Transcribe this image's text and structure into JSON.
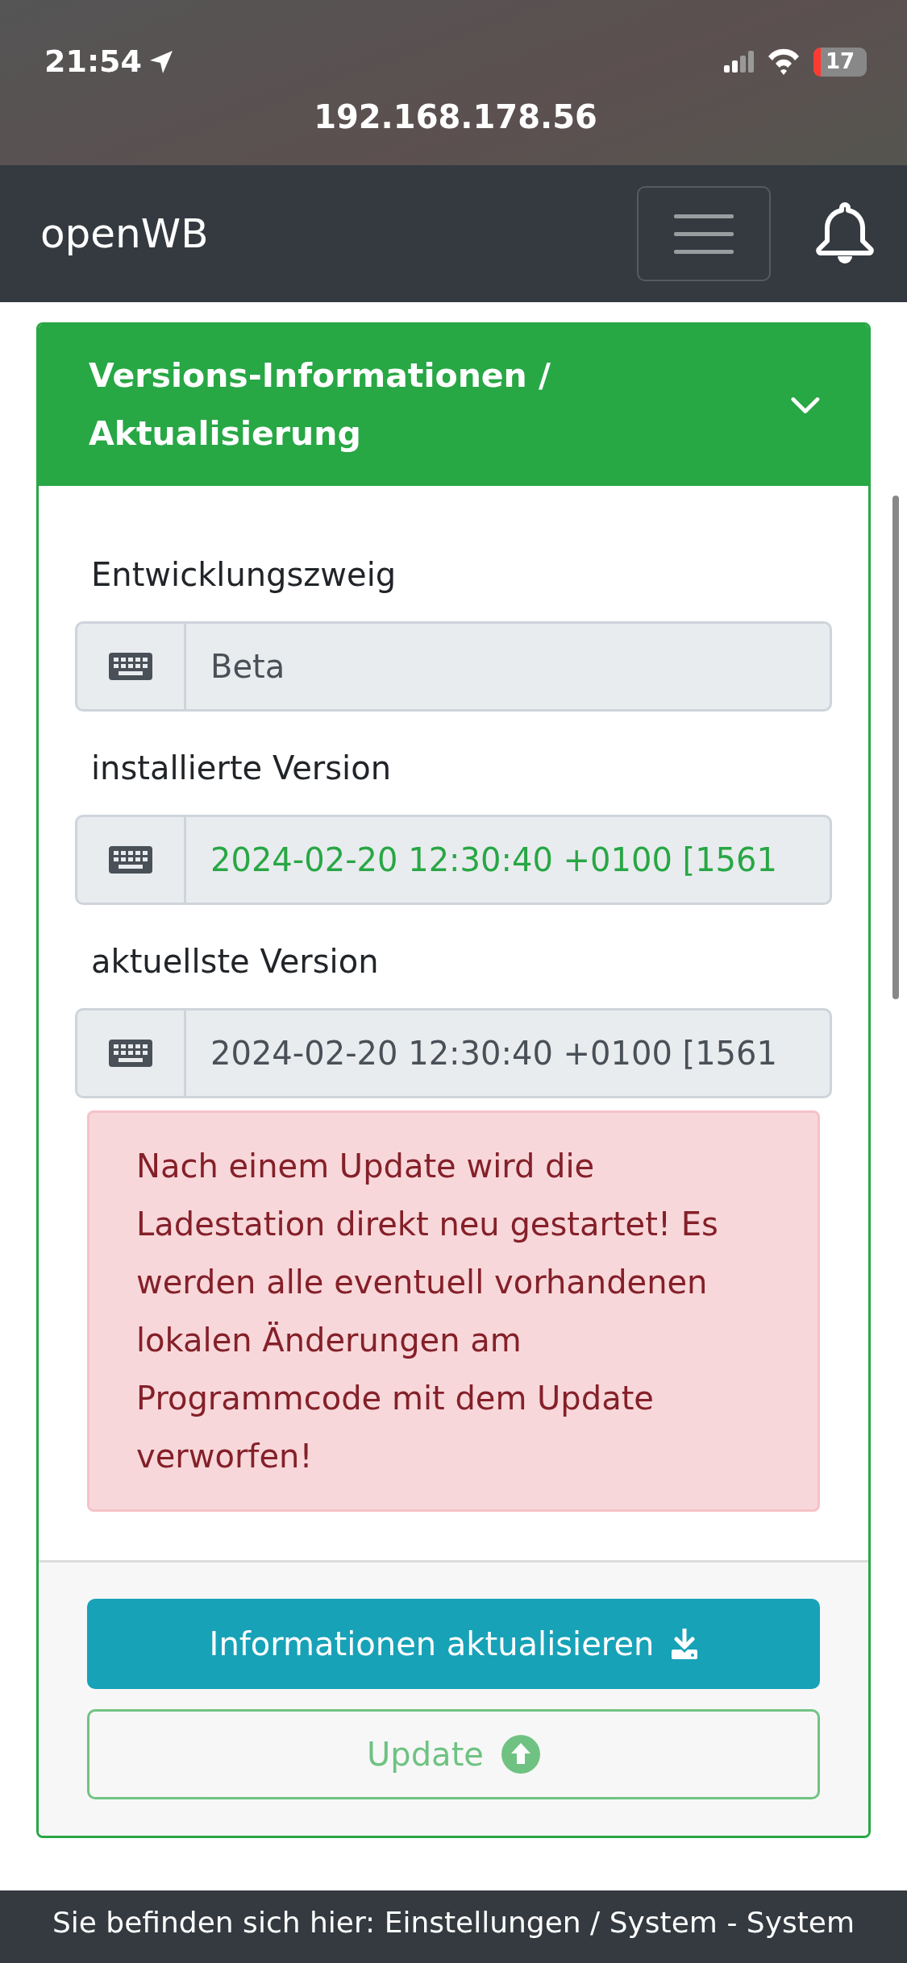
{
  "status_bar": {
    "time": "21:54",
    "battery": "17",
    "url": "192.168.178.56"
  },
  "navbar": {
    "brand": "openWB"
  },
  "card": {
    "title": "Versions-Informationen / Aktualisierung",
    "expanded": true,
    "fields": [
      {
        "label": "Entwicklungszweig",
        "value": "Beta",
        "highlighted": false
      },
      {
        "label": "installierte Version",
        "value": "2024-02-20 12:30:40 +0100 [1561",
        "highlighted": true
      },
      {
        "label": "aktuellste Version",
        "value": "2024-02-20 12:30:40 +0100 [1561",
        "highlighted": false
      }
    ],
    "alert": "Nach einem Update wird die Ladestation direkt neu gestartet! Es werden alle eventuell vorhandenen lokalen Änderungen am Programmcode mit dem Update verworfen!",
    "buttons": [
      {
        "kind": "refresh",
        "label": "Informationen aktualisieren",
        "disabled": false
      },
      {
        "kind": "update",
        "label": "Update",
        "disabled": true
      }
    ]
  },
  "footer": {
    "breadcrumb": "Sie befinden sich hier: Einstellungen / System - System"
  }
}
